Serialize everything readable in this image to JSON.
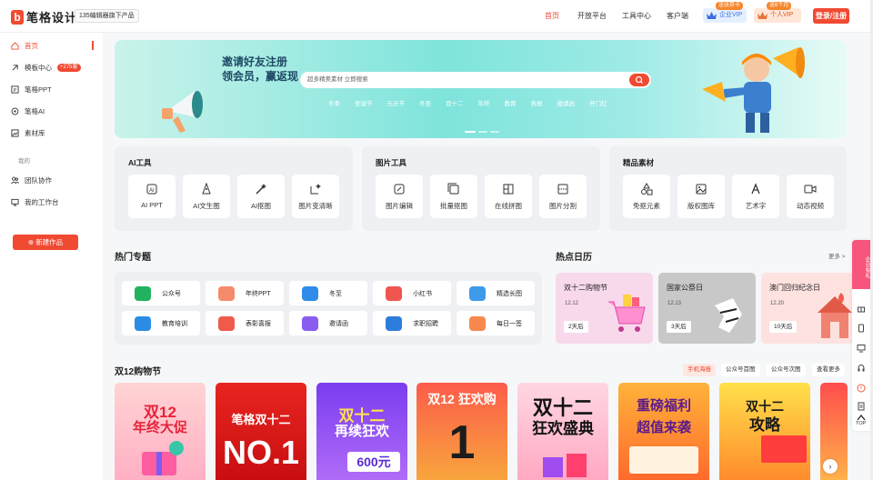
{
  "header": {
    "logo_text": "笔格设计",
    "slogan": "135编辑器旗下产品",
    "nav": [
      "首页",
      "开放平台",
      "工具中心",
      "客户端"
    ],
    "enterprise_vip": {
      "label": "企业VIP",
      "tag": "送张券卡"
    },
    "personal_vip": {
      "label": "个人VIP",
      "tag": "送6个月"
    },
    "login_label": "登录/注册"
  },
  "sidebar": {
    "items": [
      {
        "label": "首页",
        "icon": "home-icon"
      },
      {
        "label": "模板中心",
        "icon": "template-icon",
        "badge": "+275套"
      },
      {
        "label": "笔格PPT",
        "icon": "ppt-icon"
      },
      {
        "label": "笔格AI",
        "icon": "ai-icon"
      },
      {
        "label": "素材库",
        "icon": "image-icon"
      }
    ],
    "mine_caption": "我的",
    "mine_items": [
      {
        "label": "团队协作",
        "icon": "team-icon"
      },
      {
        "label": "我的工作台",
        "icon": "desktop-icon"
      }
    ],
    "create_label": "新建作品"
  },
  "banner": {
    "headline_1": "邀请好友注册",
    "headline_2": "领会员，赢返现",
    "search_placeholder": "超多精美素材 立即搜索",
    "hot_words": [
      "冬季",
      "圣诞节",
      "元旦节",
      "冬至",
      "双十二",
      "年终",
      "教育",
      "表报",
      "邀请函",
      "开门红"
    ]
  },
  "tool_panels": [
    {
      "title": "AI工具",
      "tools": [
        "AI PPT",
        "AI文生图",
        "AI抠图",
        "图片变清晰"
      ]
    },
    {
      "title": "图片工具",
      "tools": [
        "图片编辑",
        "批量抠图",
        "在线拼图",
        "图片分割"
      ]
    },
    {
      "title": "精品素材",
      "tools": [
        "免抠元素",
        "版权图库",
        "艺术字",
        "动态视频"
      ]
    }
  ],
  "hot_topics": {
    "title": "热门专题",
    "items": [
      "公众号",
      "年终PPT",
      "冬至",
      "小红书",
      "精选长图",
      "教育培训",
      "表彰喜报",
      "邀请函",
      "求职招聘",
      "每日一签"
    ]
  },
  "calendar": {
    "title": "热点日历",
    "more": "更多 >",
    "items": [
      {
        "title": "双十二购物节",
        "date": "12.12",
        "countdown": "2天后"
      },
      {
        "title": "国家公祭日",
        "date": "12.13",
        "countdown": "3天后"
      },
      {
        "title": "澳门回归纪念日",
        "date": "12.20",
        "countdown": "10天后"
      }
    ]
  },
  "shopping": {
    "title": "双12购物节",
    "tabs": [
      "手机海报",
      "公众号首图",
      "公众号次图",
      "查看更多"
    ],
    "posters": [
      {
        "line1": "双12",
        "line2": "年终大促"
      },
      {
        "line1": "笔格双十二",
        "line2": "NO.1"
      },
      {
        "line1": "双十二",
        "line2": "再续狂欢",
        "price": "600元"
      },
      {
        "line1": "双12 狂欢购",
        "line2": "1"
      },
      {
        "line1": "双十二",
        "line2": "狂欢盛典"
      },
      {
        "line1": "重磅福利",
        "line2": "超值来袭"
      },
      {
        "line1": "双十二",
        "line2": "攻略"
      }
    ]
  },
  "rail": {
    "promo": "企业有礼",
    "top_label": "TOP"
  },
  "colors": {
    "brand": "#f04a32",
    "panel": "#eef0f3"
  }
}
